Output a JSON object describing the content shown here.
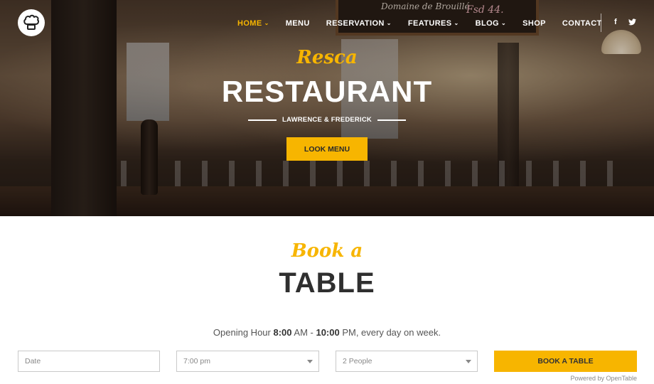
{
  "brand": {
    "logo_icon": "chef-hat-icon"
  },
  "nav": {
    "items": [
      {
        "label": "HOME",
        "dropdown": true,
        "active": true
      },
      {
        "label": "MENU",
        "dropdown": false,
        "active": false
      },
      {
        "label": "RESERVATION",
        "dropdown": true,
        "active": false
      },
      {
        "label": "FEATURES",
        "dropdown": true,
        "active": false
      },
      {
        "label": "BLOG",
        "dropdown": true,
        "active": false
      },
      {
        "label": "SHOP",
        "dropdown": false,
        "active": false
      },
      {
        "label": "CONTACT",
        "dropdown": false,
        "active": false
      }
    ],
    "social": {
      "facebook": "f",
      "twitter_icon": "twitter-icon"
    }
  },
  "hero": {
    "script_title": "Resca",
    "title": "RESTAURANT",
    "subtitle": "LAWRENCE & FREDERICK",
    "button_label": "LOOK MENU",
    "chalkboard_text": "Domaine de Brouillé",
    "chalkboard_price": "Fsd 44."
  },
  "booking": {
    "script_title": "Book a",
    "title": "TABLE",
    "hours": {
      "prefix": "Opening Hour ",
      "open_time": "8:00",
      "open_suffix": " AM - ",
      "close_time": "10:00",
      "close_suffix": " PM, every day on week."
    },
    "date_placeholder": "Date",
    "time_value": "7:00 pm",
    "people_value": "2 People",
    "button_label": "BOOK A TABLE",
    "powered_by": "Powered by OpenTable"
  },
  "colors": {
    "accent": "#f7b500",
    "text_dark": "#2f2f2f"
  }
}
